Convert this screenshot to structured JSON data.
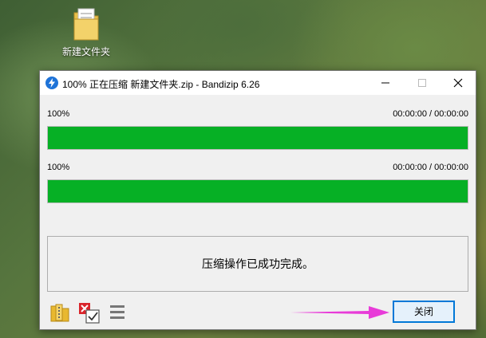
{
  "desktop": {
    "folder_label": "新建文件夹"
  },
  "window": {
    "title": "100% 正在压缩 新建文件夹.zip - Bandizip 6.26",
    "progress_file": {
      "percent_label": "100%",
      "time": "00:00:00 / 00:00:00",
      "value": 1.0
    },
    "progress_total": {
      "percent_label": "100%",
      "time": "00:00:00 / 00:00:00",
      "value": 1.0
    },
    "message": "压缩操作已成功完成。",
    "close_button": "关闭",
    "toolbar_icons": [
      "open-folder-icon",
      "delete-check-icon",
      "menu-icon"
    ],
    "colors": {
      "progress": "#06b025",
      "focus_border": "#0078d7",
      "annotation_arrow": "#e83bd8"
    }
  }
}
